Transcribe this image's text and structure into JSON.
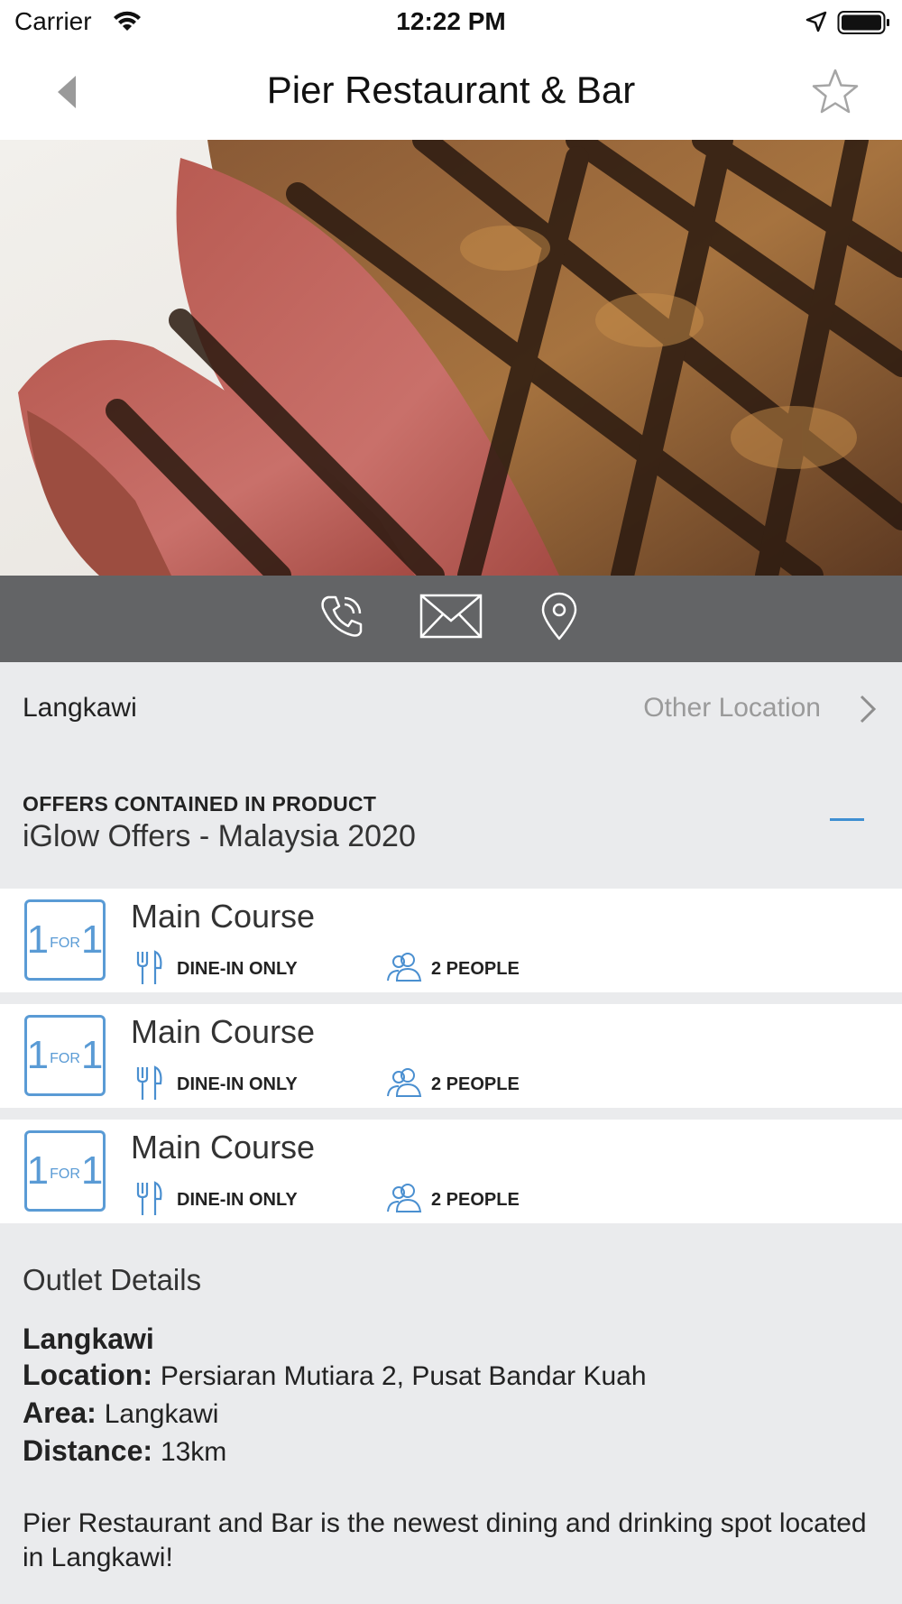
{
  "status_bar": {
    "carrier": "Carrier",
    "time": "12:22 PM"
  },
  "nav": {
    "title": "Pier Restaurant & Bar",
    "back_icon": "back-chevron-icon",
    "favorite_icon": "star-icon"
  },
  "hero": {
    "image": "grilled steak photo",
    "pages": 3,
    "current_page": 1
  },
  "actions": [
    {
      "name": "phone-icon"
    },
    {
      "name": "email-icon"
    },
    {
      "name": "map-pin-icon"
    }
  ],
  "location": {
    "current": "Langkawi",
    "other_label": "Other Location"
  },
  "offers": {
    "header_label": "OFFERS CONTAINED IN PRODUCT",
    "product_name": "iGlow Offers - Malaysia 2020",
    "items": [
      {
        "badge_big": "1",
        "badge_small": "FOR",
        "badge_big2": "1",
        "title": "Main Course",
        "dine": "DINE-IN ONLY",
        "people": "2 PEOPLE"
      },
      {
        "badge_big": "1",
        "badge_small": "FOR",
        "badge_big2": "1",
        "title": "Main Course",
        "dine": "DINE-IN ONLY",
        "people": "2 PEOPLE"
      },
      {
        "badge_big": "1",
        "badge_small": "FOR",
        "badge_big2": "1",
        "title": "Main Course",
        "dine": "DINE-IN ONLY",
        "people": "2 PEOPLE"
      }
    ]
  },
  "outlet": {
    "title": "Outlet Details",
    "name": "Langkawi",
    "location_label": "Location:",
    "location_value": "Persiaran Mutiara 2, Pusat Bandar Kuah",
    "area_label": "Area:",
    "area_value": "Langkawi",
    "distance_label": "Distance:",
    "distance_value": "13km",
    "description": "Pier Restaurant and Bar is the newest dining and drinking spot located in Langkawi!"
  },
  "colors": {
    "accent": "#3f8fd2",
    "action_bar": "#636466",
    "background": "#eaebed"
  }
}
